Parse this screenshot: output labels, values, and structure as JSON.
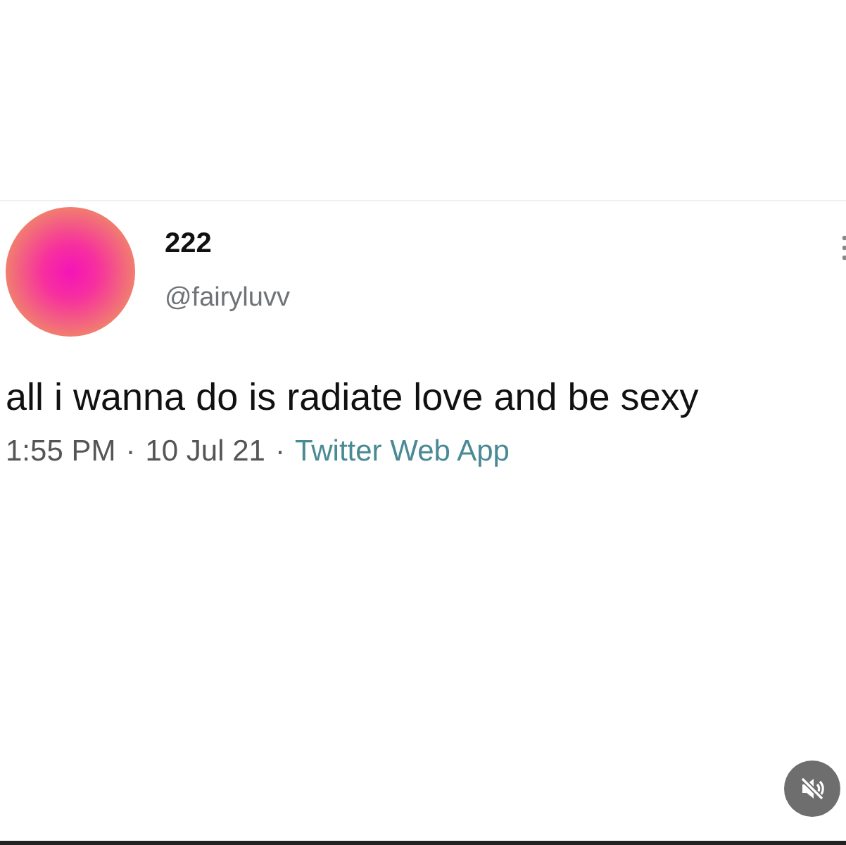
{
  "tweet": {
    "author": {
      "name": "222",
      "handle": "@fairyluvv"
    },
    "text": "all i wanna do is radiate love and be sexy",
    "meta": [
      {
        "kind": "time",
        "text": "1:55 PM"
      },
      {
        "kind": "separator",
        "text": "·"
      },
      {
        "kind": "date",
        "text": "10 Jul 21"
      },
      {
        "kind": "separator",
        "text": "·"
      },
      {
        "kind": "source",
        "text": "Twitter Web App"
      }
    ]
  },
  "mute_button": {
    "muted": true
  }
}
